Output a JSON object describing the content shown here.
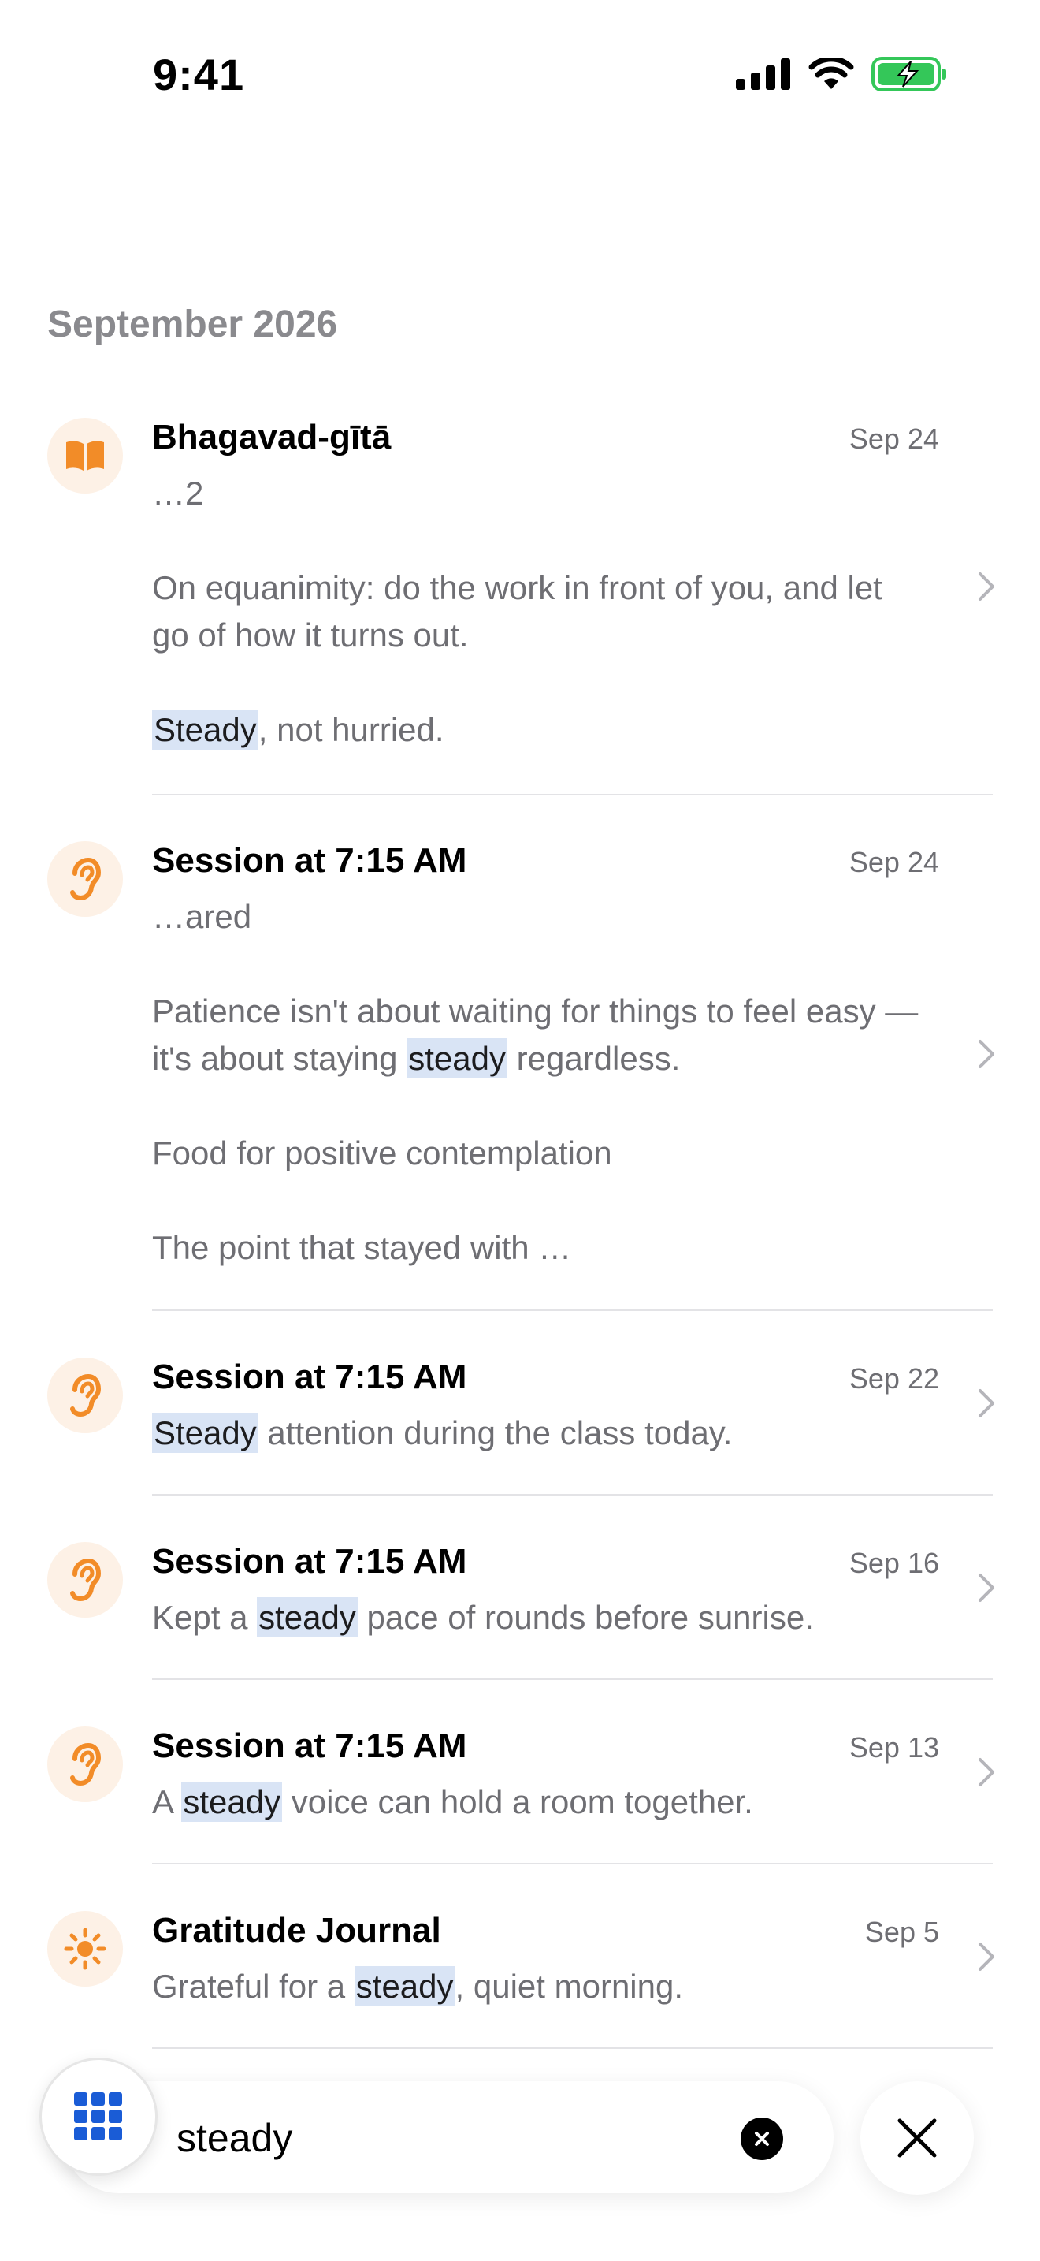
{
  "status_bar": {
    "time": "9:41"
  },
  "month_header": "September 2026",
  "colors": {
    "accent_orange": "#f28c28",
    "avatar_bg": "#fdf1e6",
    "highlight": "#d9e4f5",
    "grid_blue": "#1a5cd6"
  },
  "entries": [
    {
      "icon": "book-icon",
      "title": "Bhagavad-gītā",
      "date": "Sep 24",
      "paragraphs": [
        {
          "text": "…2"
        },
        {
          "text": "On equanimity: do the work in front of you, and let go of how it turns out."
        },
        {
          "before": "",
          "match": "Steady",
          "after": ", not hurried."
        }
      ]
    },
    {
      "icon": "ear-icon",
      "title": "Session at 7:15 AM",
      "date": "Sep 24",
      "paragraphs": [
        {
          "text": "…ared"
        },
        {
          "before": "Patience isn't about waiting for things to feel easy — it's about staying ",
          "match": "steady",
          "after": " regardless."
        },
        {
          "text": "Food for positive contemplation"
        },
        {
          "text": "The point that stayed with …"
        }
      ]
    },
    {
      "icon": "ear-icon",
      "title": "Session at 7:15 AM",
      "date": "Sep 22",
      "paragraphs": [
        {
          "before": "",
          "match": "Steady",
          "after": " attention during the class today."
        }
      ]
    },
    {
      "icon": "ear-icon",
      "title": "Session at 7:15 AM",
      "date": "Sep 16",
      "paragraphs": [
        {
          "before": "Kept a ",
          "match": "steady",
          "after": " pace of rounds before sunrise."
        }
      ]
    },
    {
      "icon": "ear-icon",
      "title": "Session at 7:15 AM",
      "date": "Sep 13",
      "paragraphs": [
        {
          "before": "A ",
          "match": "steady",
          "after": " voice can hold a room together."
        }
      ]
    },
    {
      "icon": "sun-icon",
      "title": "Gratitude Journal",
      "date": "Sep 5",
      "paragraphs": [
        {
          "before": "Grateful for a ",
          "match": "steady",
          "after": ", quiet morning."
        }
      ]
    }
  ],
  "search": {
    "value": "steady"
  }
}
